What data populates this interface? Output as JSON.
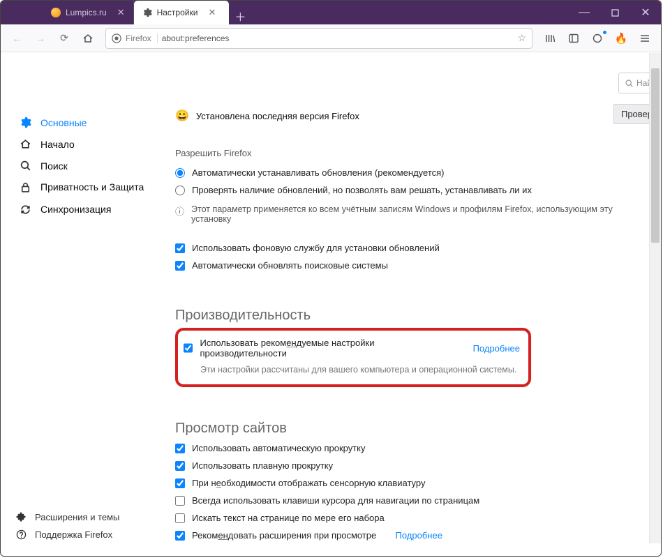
{
  "tabs": [
    {
      "title": "Lumpics.ru"
    },
    {
      "title": "Настройки"
    }
  ],
  "url": {
    "identity": "Firefox",
    "value": "about:preferences"
  },
  "window": {
    "min": "—",
    "max": "▢",
    "close": "✕"
  },
  "search": {
    "placeholder": "Най"
  },
  "sidebar": {
    "items": [
      {
        "label": "Основные"
      },
      {
        "label": "Начало"
      },
      {
        "label": "Поиск"
      },
      {
        "label": "Приватность и Защита"
      },
      {
        "label": "Синхронизация"
      }
    ],
    "footer": [
      {
        "label": "Расширения и темы"
      },
      {
        "label": "Поддержка Firefox"
      }
    ]
  },
  "main": {
    "latest_version": "Установлена последняя версия Firefox",
    "check_button": "Провер",
    "updates_title": "Разрешить Firefox",
    "radio1": "Автоматически устанавливать обновления (рекомендуется)",
    "radio2": "Проверять наличие обновлений, но позволять вам решать, устанавливать ли их",
    "info_note": "Этот параметр применяется ко всем учётным записям Windows и профилям Firefox, использующим эту установку",
    "cb_bg": "Использовать фоновую службу для установки обновлений",
    "cb_se": "Автоматически обновлять поисковые системы",
    "perf_heading": "Производительность",
    "perf_cb_a": "Использовать реком",
    "perf_cb_u": "ен",
    "perf_cb_b": "дуемые настройки производительности",
    "perf_more": "Подробнее",
    "perf_sub": "Эти настройки рассчитаны для вашего компьютера и операционной системы.",
    "browse_heading": "Просмотр сайтов",
    "browse": [
      {
        "checked": true,
        "a": "Использовать автоматическую прокрутку"
      },
      {
        "checked": true,
        "a": "Использовать плавную прокрутку"
      },
      {
        "checked": true,
        "a": "При н",
        "u": "е",
        "b": "обходимости отображать сенсорную клавиатуру"
      },
      {
        "checked": false,
        "a": "Всегда использовать клавиши курсора для навигации по страницам"
      },
      {
        "checked": false,
        "a": "Искать текст на странице по мере его набора"
      },
      {
        "checked": true,
        "a": "Реком",
        "u": "ен",
        "b": "довать расширения при просмотре",
        "link": "Подробнее"
      }
    ]
  }
}
